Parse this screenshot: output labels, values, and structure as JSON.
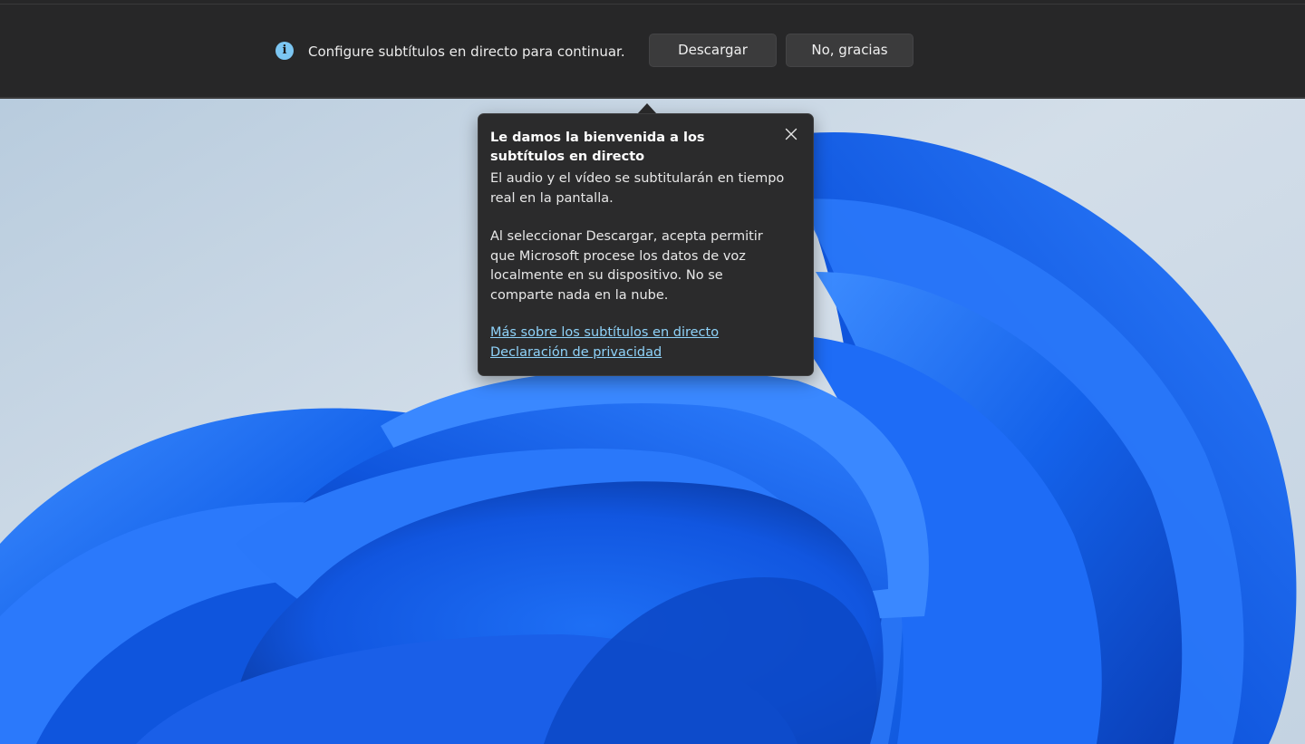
{
  "banner": {
    "info_icon": "info-icon",
    "message": "Configure subtítulos en directo para continuar.",
    "download_label": "Descargar",
    "decline_label": "No, gracias"
  },
  "flyout": {
    "title": "Le damos la bienvenida a los subtítulos en directo",
    "paragraph1": "El audio y el vídeo se subtitularán en tiempo real en la pantalla.",
    "paragraph2": "Al seleccionar Descargar, acepta permitir que Microsoft procese los datos de voz localmente en su dispositivo. No se comparte nada en la nube.",
    "link_more": "Más sobre los subtítulos en directo",
    "link_privacy": "Declaración de privacidad",
    "close_icon": "close-icon"
  },
  "colors": {
    "bar_background": "#272728",
    "flyout_background": "#2b2b2c",
    "link": "#8fd3fa",
    "info_accent": "#7cc6f2",
    "wallpaper_bloom": "#1a6cf0",
    "wallpaper_sky": "#c7d6e6"
  }
}
